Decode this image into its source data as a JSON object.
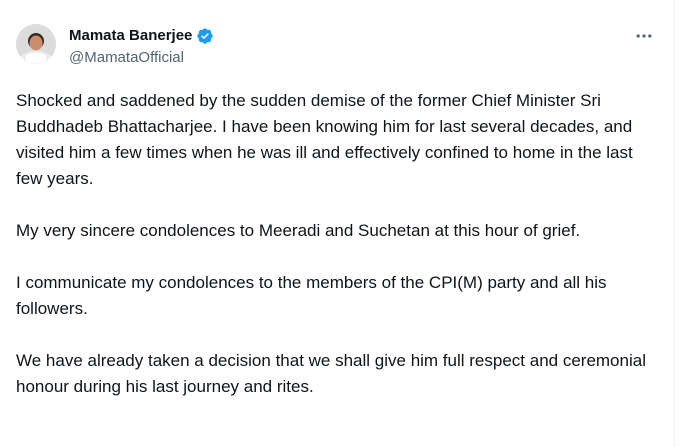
{
  "author": {
    "display_name": "Mamata Banerjee",
    "handle": "@MamataOfficial",
    "verified": true
  },
  "icons": {
    "verified": "verified-badge-icon",
    "more": "more-options-icon"
  },
  "colors": {
    "verified_blue": "#1d9bf0",
    "text_primary": "#0f1419",
    "text_secondary": "#536471"
  },
  "tweet": {
    "paragraphs": [
      "Shocked and saddened by the sudden demise of the former Chief Minister Sri Buddhadeb Bhattacharjee. I have been knowing him for last several decades, and visited him a few times when he was ill and effectively confined to home in the last few years.",
      "My very sincere condolences to Meeradi and Suchetan at this hour of grief.",
      "I communicate my condolences to the members of the CPI(M) party and all his followers.",
      "We have already taken a decision that we shall give him full respect and ceremonial honour during his last journey and rites."
    ]
  }
}
